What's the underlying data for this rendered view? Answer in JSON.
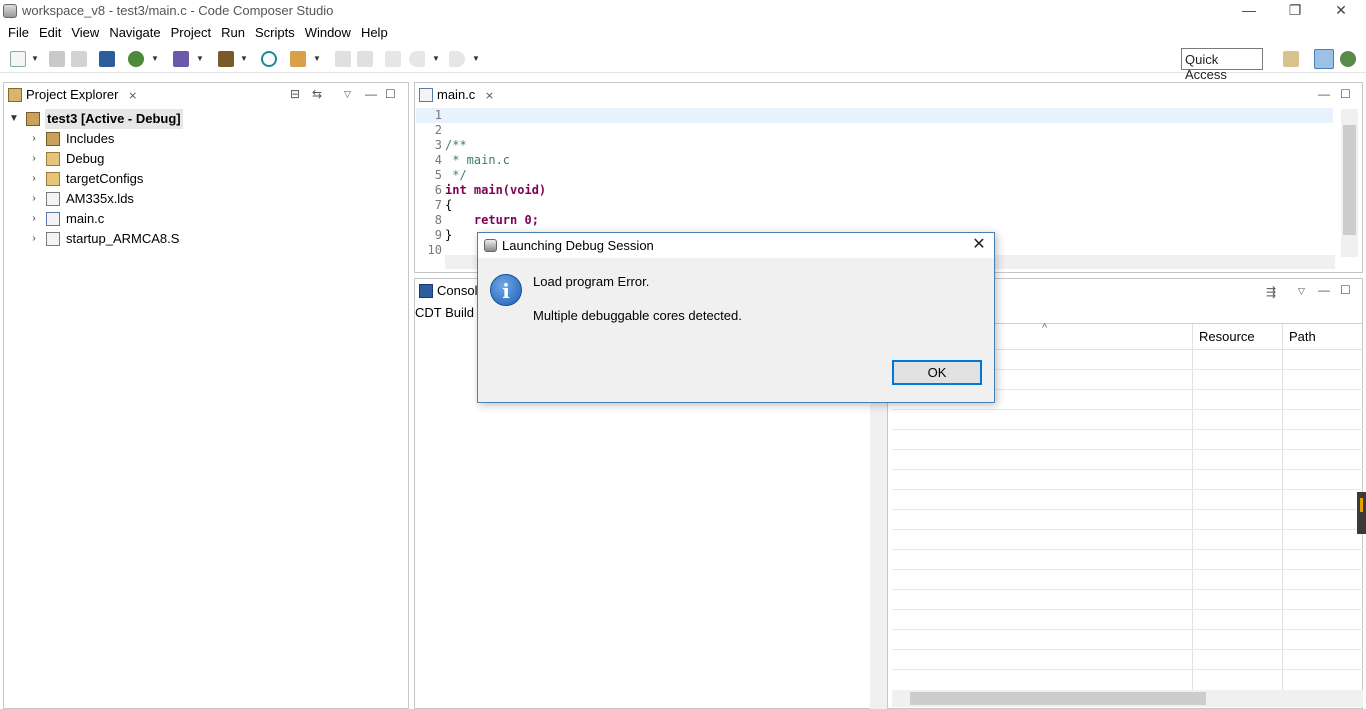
{
  "window": {
    "title": "workspace_v8 - test3/main.c - Code Composer Studio",
    "minimize": "—",
    "restore": "❐",
    "close": "✕"
  },
  "menu": [
    "File",
    "Edit",
    "View",
    "Navigate",
    "Project",
    "Run",
    "Scripts",
    "Window",
    "Help"
  ],
  "toolbar": {
    "quick_access": "Quick Access",
    "icons": [
      "new-icon",
      "save-icon",
      "save-all-icon",
      "terminal-icon",
      "debug-icon",
      "flash-icon",
      "build-icon",
      "search-icon",
      "external-tools-icon",
      "prev-annotation-icon",
      "next-annotation-icon",
      "back-icon",
      "forward-icon",
      "open-perspective-icon",
      "ccs-edit-perspective-icon",
      "ccs-debug-perspective-icon"
    ]
  },
  "explorer": {
    "tab_label": "Project Explorer",
    "tab_close": "⨯",
    "root": "test3  [Active - Debug]",
    "items": [
      {
        "label": "Includes",
        "icon": "includes-folder-icon"
      },
      {
        "label": "Debug",
        "icon": "folder-icon"
      },
      {
        "label": "targetConfigs",
        "icon": "folder-icon"
      },
      {
        "label": "AM335x.lds",
        "icon": "linker-file-icon"
      },
      {
        "label": "main.c",
        "icon": "c-file-icon"
      },
      {
        "label": "startup_ARMCA8.S",
        "icon": "asm-file-icon"
      }
    ]
  },
  "editor": {
    "tab_label": "main.c",
    "tab_close": "⨯",
    "lines": [
      {
        "n": "1",
        "text": ""
      },
      {
        "n": "2",
        "text": ""
      },
      {
        "n": "3",
        "text": "/**"
      },
      {
        "n": "4",
        "text": " * main.c"
      },
      {
        "n": "5",
        "text": " */"
      },
      {
        "n": "6",
        "text": "int main(void)"
      },
      {
        "n": "7",
        "text": "{"
      },
      {
        "n": "8",
        "text": "    return 0;"
      },
      {
        "n": "9",
        "text": "}"
      },
      {
        "n": "10",
        "text": ""
      }
    ]
  },
  "console": {
    "tab_label": "Consol",
    "sub_label": "CDT Build"
  },
  "problems": {
    "columns": [
      "Resource",
      "Path"
    ],
    "sort_indicator": "^"
  },
  "dialog": {
    "title": "Launching Debug Session",
    "close": "✕",
    "message_title": "Load program Error.",
    "message_detail": "Multiple debuggable cores detected.",
    "ok_label": "OK",
    "icon_glyph": "i"
  },
  "colors": {
    "accent": "#0078d7",
    "dialog_border": "#4a7fb5",
    "current_line": "#e8f2fe",
    "keyword": "#7f0055",
    "comment": "#3f7f5f"
  }
}
